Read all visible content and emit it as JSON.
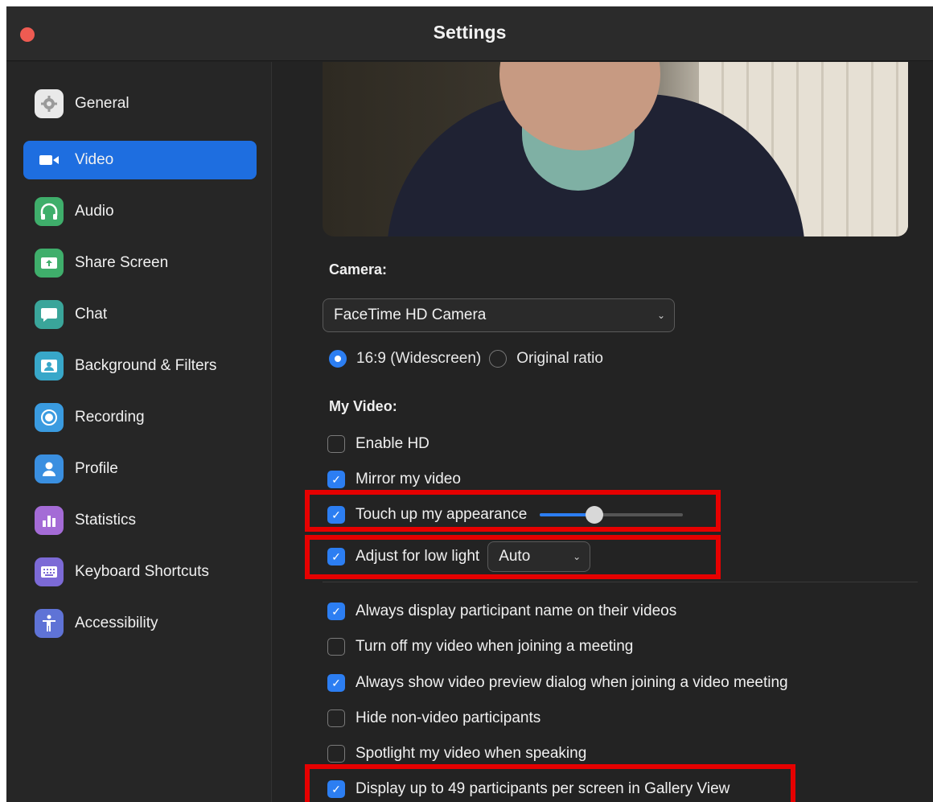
{
  "window": {
    "title": "Settings"
  },
  "sidebar": {
    "items": [
      {
        "label": "General",
        "icon": "gear-icon",
        "color": "#8a8a8a"
      },
      {
        "label": "Video",
        "icon": "video-camera-icon",
        "color": "#1e6ee0",
        "active": true
      },
      {
        "label": "Audio",
        "icon": "headphones-icon",
        "color": "#3fae6b"
      },
      {
        "label": "Share Screen",
        "icon": "share-screen-icon",
        "color": "#3fae6b"
      },
      {
        "label": "Chat",
        "icon": "chat-bubble-icon",
        "color": "#3aa59a"
      },
      {
        "label": "Background & Filters",
        "icon": "person-portrait-icon",
        "color": "#38a7c9"
      },
      {
        "label": "Recording",
        "icon": "record-icon",
        "color": "#3a9be0"
      },
      {
        "label": "Profile",
        "icon": "user-icon",
        "color": "#3a8fe0"
      },
      {
        "label": "Statistics",
        "icon": "bar-chart-icon",
        "color": "#a46bd6"
      },
      {
        "label": "Keyboard Shortcuts",
        "icon": "keyboard-icon",
        "color": "#7c6ad6"
      },
      {
        "label": "Accessibility",
        "icon": "accessibility-icon",
        "color": "#5f73d6"
      }
    ]
  },
  "video": {
    "camera_label": "Camera:",
    "camera_value": "FaceTime HD Camera",
    "ratio_options": [
      "16:9 (Widescreen)",
      "Original ratio"
    ],
    "ratio_selected": "16:9 (Widescreen)",
    "my_video_label": "My Video:",
    "enable_hd": {
      "label": "Enable HD",
      "checked": false
    },
    "mirror": {
      "label": "Mirror my video",
      "checked": true
    },
    "touch_up": {
      "label": "Touch up my appearance",
      "checked": true,
      "level": 0.36
    },
    "low_light": {
      "label": "Adjust for low light",
      "checked": true,
      "mode": "Auto"
    },
    "options": [
      {
        "label": "Always display participant name on their videos",
        "checked": true
      },
      {
        "label": "Turn off my video when joining a meeting",
        "checked": false
      },
      {
        "label": "Always show video preview dialog when joining a video meeting",
        "checked": true
      },
      {
        "label": "Hide non-video participants",
        "checked": false
      },
      {
        "label": "Spotlight my video when speaking",
        "checked": false
      },
      {
        "label": "Display up to 49 participants per screen in Gallery View",
        "checked": true
      }
    ]
  },
  "colors": {
    "accent": "#2c7ef2",
    "highlight": "#e60000"
  }
}
